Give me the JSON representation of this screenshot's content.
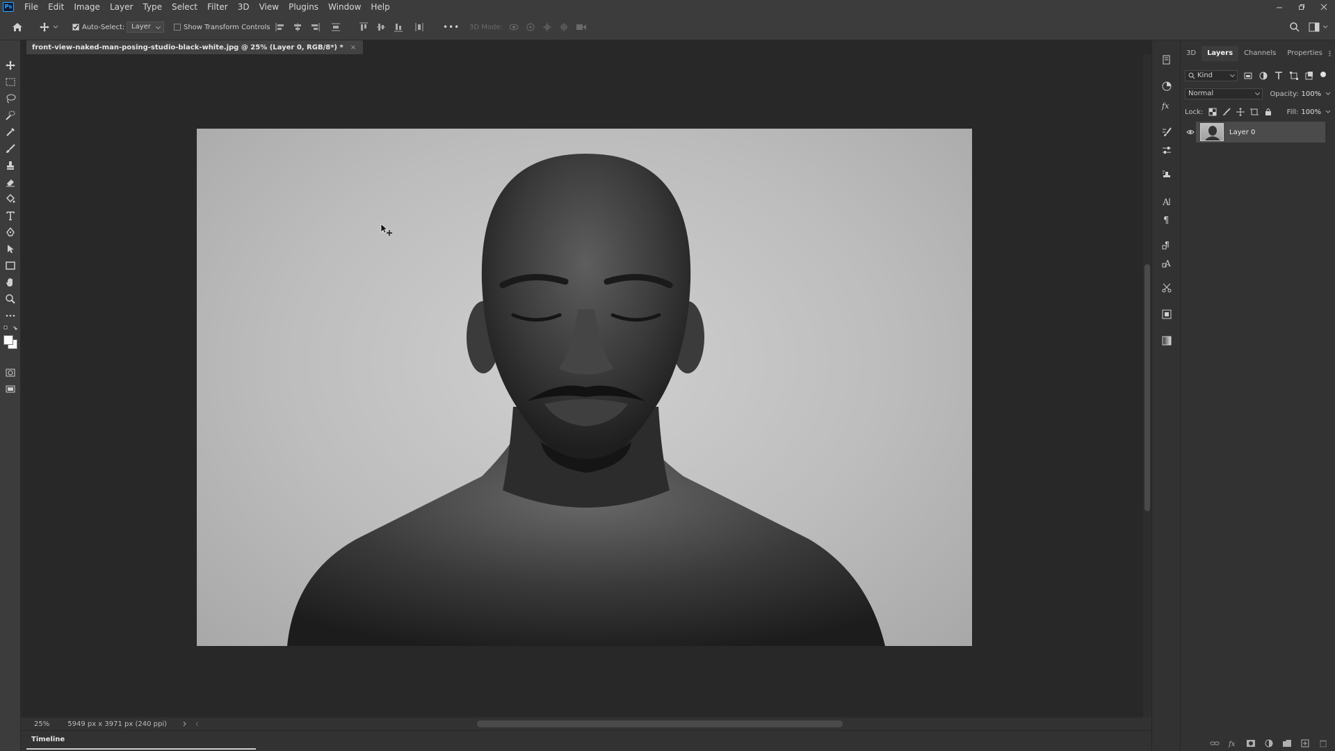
{
  "app": {
    "logo_text": "Ps",
    "menu": [
      "File",
      "Edit",
      "Image",
      "Layer",
      "Type",
      "Select",
      "Filter",
      "3D",
      "View",
      "Plugins",
      "Window",
      "Help"
    ]
  },
  "options_bar": {
    "auto_select_label": "Auto-Select:",
    "auto_select_checked": true,
    "auto_select_target": "Layer",
    "show_transform_label": "Show Transform Controls",
    "show_transform_checked": false,
    "more_label": "•••",
    "mode_label": "3D Mode:"
  },
  "document": {
    "tab_title": "front-view-naked-man-posing-studio-black-white.jpg @ 25% (Layer 0, RGB/8*) *",
    "close_glyph": "×"
  },
  "status": {
    "zoom": "25%",
    "doc_info": "5949 px x 3971 px (240 ppi)"
  },
  "timeline": {
    "tab_label": "Timeline"
  },
  "layers_panel": {
    "tabs": [
      "3D",
      "Layers",
      "Channels",
      "Properties"
    ],
    "active_tab": "Layers",
    "filter_kind": "Kind",
    "blend_mode": "Normal",
    "opacity_label": "Opacity:",
    "opacity_value": "100%",
    "lock_label": "Lock:",
    "fill_label": "Fill:",
    "fill_value": "100%",
    "layers": [
      {
        "name": "Layer 0",
        "visible": true,
        "selected": true
      }
    ]
  },
  "colors": {
    "foreground": "#ffffff",
    "background": "#ffffff",
    "accent": "#31a8ff"
  }
}
